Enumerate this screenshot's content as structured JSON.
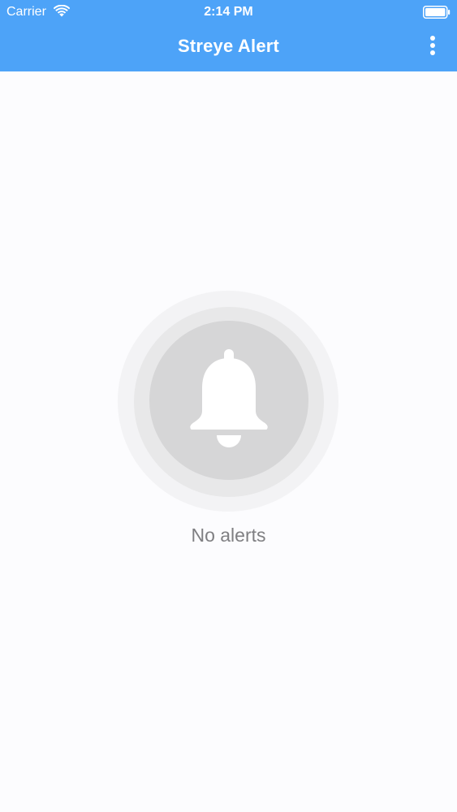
{
  "status_bar": {
    "carrier": "Carrier",
    "time": "2:14 PM",
    "wifi_icon": "wifi-icon",
    "battery_icon": "battery-icon"
  },
  "nav_bar": {
    "title": "Streye Alert",
    "menu_icon": "vertical-ellipsis-icon",
    "background_color": "#4da3f8"
  },
  "empty_state": {
    "icon": "bell-icon",
    "message": "No alerts"
  }
}
